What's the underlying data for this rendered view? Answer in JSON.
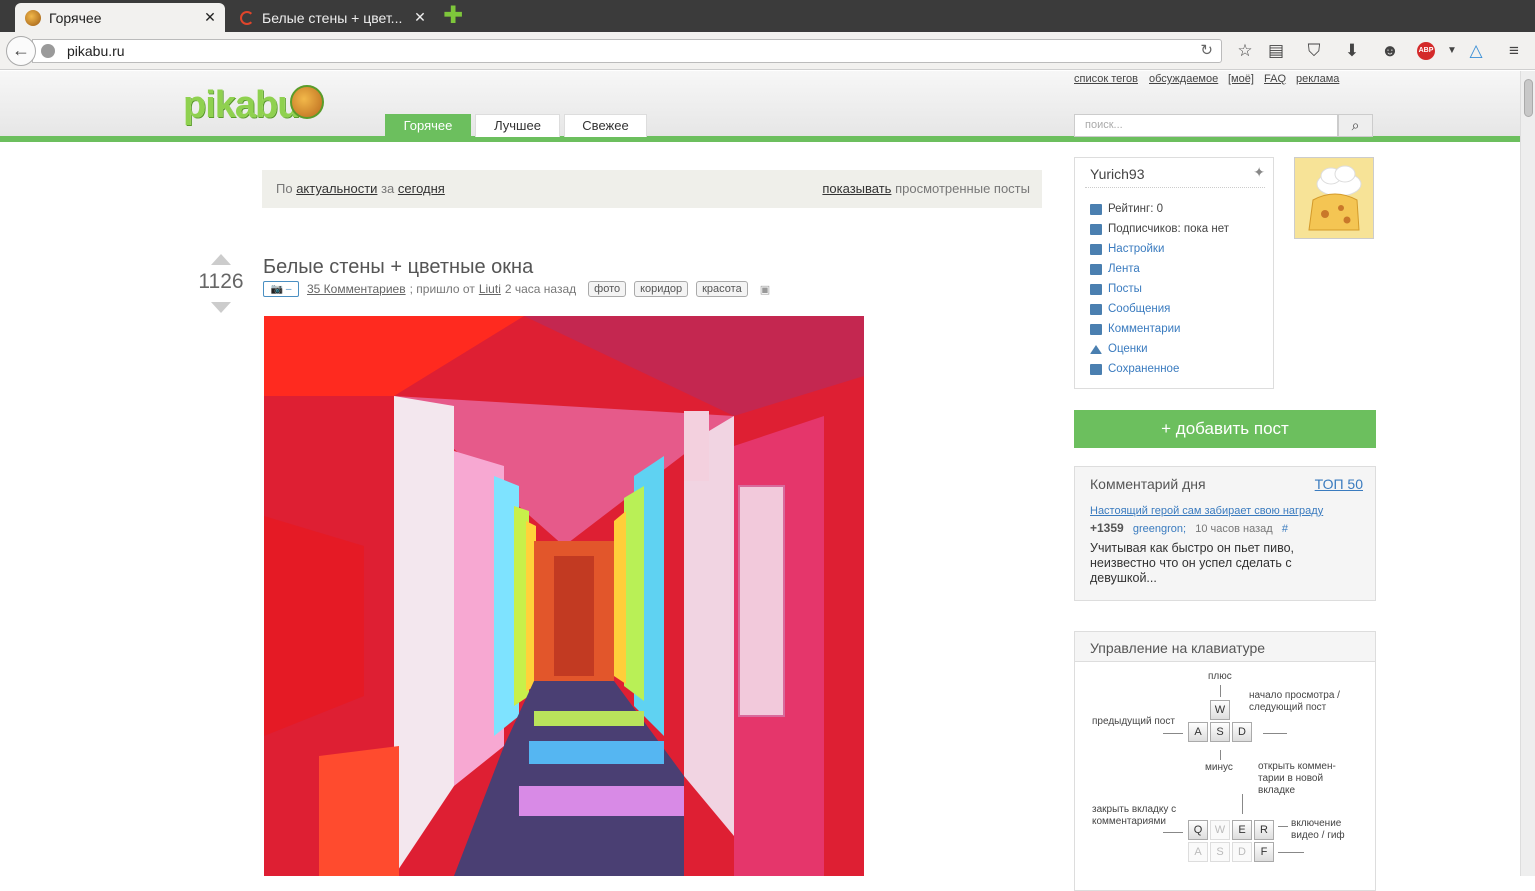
{
  "browser": {
    "tabs": [
      {
        "title": "Горячее",
        "close": "✕"
      },
      {
        "title": "Белые стены + цвет...",
        "close": "✕"
      }
    ],
    "new_tab": "✚",
    "url": "pikabu.ru",
    "reload": "↻",
    "back": "←",
    "toolbar_icons": [
      "star-icon",
      "reading-list-icon",
      "pocket-icon",
      "download-icon",
      "emoji-icon",
      "adblock-icon",
      "sync-icon",
      "menu-icon"
    ],
    "adblock_label": "ABP"
  },
  "site": {
    "logo": "pikabu",
    "toplinks": [
      "список тегов",
      "обсуждаемое",
      "[моё]",
      "FAQ",
      "реклама"
    ],
    "nav_tabs": [
      "Горячее",
      "Лучшее",
      "Свежее"
    ],
    "search_placeholder": "поиск...",
    "search_icon": "🔍",
    "accent": "#6cbf5e"
  },
  "filter": {
    "prefix": "По",
    "sort": "актуальности",
    "for": "за",
    "period": "сегодня",
    "show_link": "показывать",
    "show_suffix": "просмотренные посты"
  },
  "post": {
    "rating": "1126",
    "title": "Белые стены + цветные окна",
    "cam_label": "📷 –",
    "comments_link": "35 Комментариев",
    "came_from": "; пришло от",
    "author": "Liuti",
    "time": "2 часа назад",
    "tags": [
      "фото",
      "коридор",
      "красота"
    ],
    "save_icon": "💾"
  },
  "user": {
    "name": "Yurich93",
    "pin_icon": "📌",
    "stats": [
      {
        "label": "Рейтинг: 0",
        "link": false
      },
      {
        "label": "Подписчиков: пока нет",
        "link": false
      },
      {
        "label": "Настройки",
        "link": true
      },
      {
        "label": "Лента",
        "link": true
      },
      {
        "label": "Посты",
        "link": true
      },
      {
        "label": "Сообщения",
        "link": true
      },
      {
        "label": "Комментарии",
        "link": true
      },
      {
        "label": "Оценки",
        "link": true
      },
      {
        "label": "Сохраненное",
        "link": true
      }
    ]
  },
  "add_post": "+  добавить пост",
  "comment_of_day": {
    "header": "Комментарий дня",
    "top_link": "ТОП 50",
    "post_link": "Настоящий герой сам забирает свою награду",
    "score": "+1359",
    "author": "greengron;",
    "time": "10 часов назад",
    "hash": "#",
    "text": "Учитывая как быстро он пьет пиво, неизвестно что он успел сделать с девушкой..."
  },
  "keyboard": {
    "header": "Управление на клавиатуре",
    "plus": "плюс",
    "minus": "минус",
    "prev_post": "предыдущий пост",
    "next_post": "начало просмотра / следующий пост",
    "open_comments": "открыть коммен-тарии в новой вкладке",
    "close_tab": "закрыть вкладку с комментариями",
    "video": "включение видео / гиф",
    "keys1": [
      "W",
      "A",
      "S",
      "D"
    ],
    "keys2": [
      "Q",
      "W",
      "E",
      "R",
      "A",
      "S",
      "D",
      "F"
    ]
  }
}
